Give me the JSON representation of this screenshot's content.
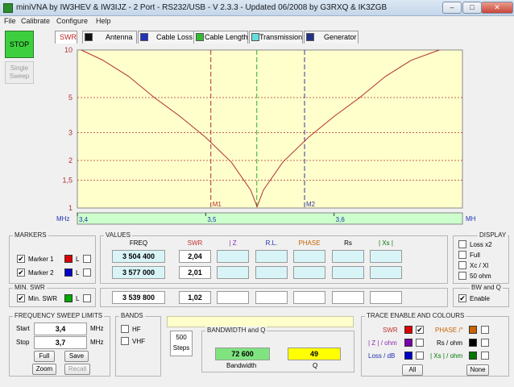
{
  "window": {
    "title": "miniVNA by IW3HEV & IW3IJZ - 2 Port - RS232/USB - V 2.3.3 - Updated 06/2008 by G3RXQ & IK3ZGB",
    "min_label": "–",
    "max_label": "□",
    "close_label": "✕"
  },
  "menu": [
    "File",
    "Calibrate",
    "Configure",
    "Help"
  ],
  "left": {
    "stop": "STOP",
    "single_sweep_line1": "Single",
    "single_sweep_line2": "Sweep"
  },
  "tabs": {
    "swr": "SWR",
    "antenna": "Antenna",
    "cable_loss": "Cable Loss",
    "cable_length": "Cable Length",
    "transmission": "Transmission",
    "generator": "Generator"
  },
  "chart_data": {
    "type": "line",
    "y_scale": "log",
    "ylim": [
      1,
      10
    ],
    "xlim": [
      3.4,
      3.7
    ],
    "y_ticks": [
      "10",
      "5",
      "3",
      "2",
      "1,5",
      "1"
    ],
    "y_tick_values": [
      10,
      5,
      3,
      2,
      1.5,
      1
    ],
    "x_ticks": [
      "3,4",
      "3,5",
      "3,6"
    ],
    "x_tick_values": [
      3.4,
      3.5,
      3.6
    ],
    "x_unit_left": "MHz",
    "x_unit_right": "MHz",
    "series": [
      {
        "x": [
          3.403,
          3.42,
          3.44,
          3.46,
          3.48,
          3.5,
          3.52,
          3.535,
          3.54,
          3.545,
          3.56,
          3.58,
          3.6,
          3.62,
          3.64,
          3.66,
          3.682
        ],
        "y": [
          10,
          8.6,
          6.8,
          5.0,
          3.8,
          2.8,
          1.95,
          1.3,
          1.02,
          1.3,
          1.95,
          2.8,
          3.8,
          5.0,
          6.8,
          8.6,
          10
        ]
      }
    ],
    "markers": [
      {
        "label": "M1",
        "x": 3.504
      },
      {
        "label": "",
        "x": 3.5398
      },
      {
        "label": "M2",
        "x": 3.577
      }
    ],
    "grid": true
  },
  "markers": {
    "title": "MARKERS",
    "m1_label": "Marker 1",
    "m2_label": "Marker 2",
    "l_label": "L",
    "min_swr_title": "MIN. SWR",
    "min_swr_label": "Min. SWR"
  },
  "values": {
    "title": "VALUES",
    "headers": {
      "freq": "FREQ",
      "swr": "SWR",
      "z": "| Z",
      "rl": "R.L.",
      "phase": "PHASE",
      "rs": "Rs",
      "xs": "| Xs |"
    },
    "m1": {
      "freq": "3 504 400",
      "swr": "2,04"
    },
    "m2": {
      "freq": "3 577 000",
      "swr": "2,01"
    },
    "min": {
      "freq": "3 539 800",
      "swr": "1,02"
    }
  },
  "display": {
    "title": "DISPLAY",
    "loss_x2": "Loss x2",
    "full": "Full",
    "xc_xl": "Xc / Xl",
    "ohm50": "50 ohm"
  },
  "bwq": {
    "title": "BW and Q",
    "enable": "Enable"
  },
  "sweep": {
    "title": "FREQUENCY SWEEP LIMITS",
    "start_label": "Start",
    "start_value": "3,4",
    "stop_label": "Stop",
    "stop_value": "3,7",
    "unit": "MHz",
    "full": "Full",
    "save": "Save",
    "zoom": "Zoom",
    "recall": "Recall"
  },
  "bands": {
    "title": "BANDS",
    "hf": "HF",
    "vhf": "VHF"
  },
  "steps": {
    "value": "500",
    "label": "Steps"
  },
  "bandwidth": {
    "title": "BANDWIDTH and Q",
    "bw_value": "72 600",
    "bw_label": "Bandwidth",
    "q_value": "49",
    "q_label": "Q"
  },
  "trace": {
    "title": "TRACE ENABLE AND COLOURS",
    "swr": "SWR",
    "phase": "PHASE /°",
    "z": "| Z | / ohm",
    "rs": "Rs / ohm",
    "loss": "Loss / dB",
    "xs": "| Xs | / ohm",
    "all": "All",
    "none": "None"
  },
  "colors": {
    "plot_bg": "#ffffcc",
    "trace": "#b03030",
    "marker1": "#b03030",
    "marker2": "#3333aa",
    "min_marker": "#33aa33",
    "axis_bar": "#ccffcc",
    "red": "#dd0000",
    "blue": "#0000cc",
    "green": "#00aa00",
    "orange": "#c86400",
    "purple": "#7a00aa",
    "black": "#000000",
    "dkgreen": "#007700",
    "bw_green": "#7fe37f",
    "q_yellow": "#ffff00"
  }
}
